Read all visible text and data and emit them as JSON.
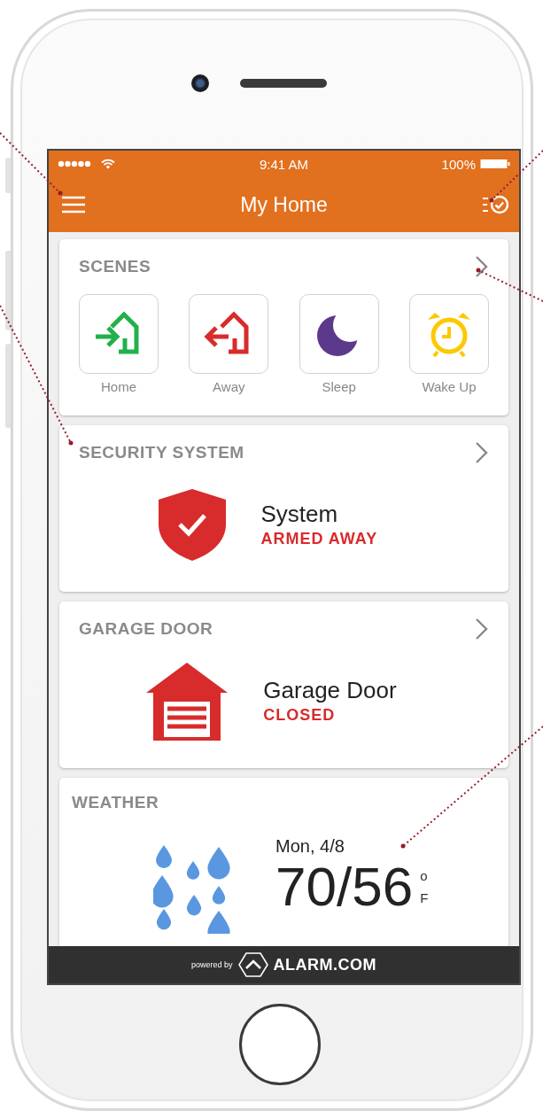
{
  "status_bar": {
    "time": "9:41 AM",
    "battery": "100%"
  },
  "header": {
    "title": "My Home"
  },
  "cards": [
    {
      "kind": "scenes",
      "title": "SCENES",
      "scenes": [
        {
          "kind": "home",
          "label": "Home"
        },
        {
          "kind": "away",
          "label": "Away"
        },
        {
          "kind": "sleep",
          "label": "Sleep"
        },
        {
          "kind": "wake",
          "label": "Wake Up"
        }
      ]
    },
    {
      "kind": "security",
      "title": "SECURITY SYSTEM",
      "name": "System",
      "status": "ARMED AWAY"
    },
    {
      "kind": "garage",
      "title": "GARAGE DOOR",
      "name": "Garage Door",
      "status": "CLOSED"
    },
    {
      "kind": "weather",
      "title": "WEATHER",
      "date": "Mon, 4/8",
      "temps": "70/56",
      "unit_top": "o",
      "unit_bottom": "F"
    }
  ],
  "footer": {
    "prefix": "powered by",
    "brand": "ALARM.COM"
  }
}
